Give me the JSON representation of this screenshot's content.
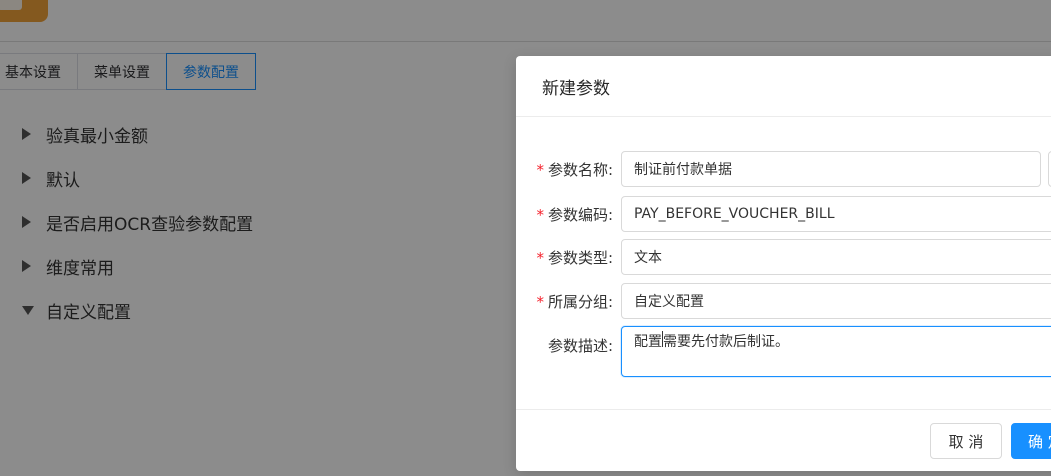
{
  "tabs": [
    {
      "label": "基本设置"
    },
    {
      "label": "菜单设置"
    },
    {
      "label": "参数配置",
      "active": true
    }
  ],
  "tree": [
    {
      "label": "验真最小金额",
      "expanded": false
    },
    {
      "label": "默认",
      "expanded": false
    },
    {
      "label": "是否启用OCR查验参数配置",
      "expanded": false
    },
    {
      "label": "维度常用",
      "expanded": false
    },
    {
      "label": "自定义配置",
      "expanded": true
    }
  ],
  "dialog": {
    "title": "新建参数",
    "fields": {
      "name": {
        "label": "参数名称:",
        "value": "制证前付款单据"
      },
      "code": {
        "label": "参数编码:",
        "value": "PAY_BEFORE_VOUCHER_BILL"
      },
      "type": {
        "label": "参数类型:",
        "value": "文本"
      },
      "group": {
        "label": "所属分组:",
        "value": "自定义配置"
      },
      "desc": {
        "label": "参数描述:",
        "value_before_cursor": "配置",
        "value_after_cursor": "需要先付款后制证。"
      }
    },
    "required_mark": "*",
    "cancel_label": "取 消",
    "ok_label": "确 定"
  },
  "colors": {
    "primary": "#1890ff",
    "required": "#f5222d",
    "logo": "#f0a23a"
  }
}
